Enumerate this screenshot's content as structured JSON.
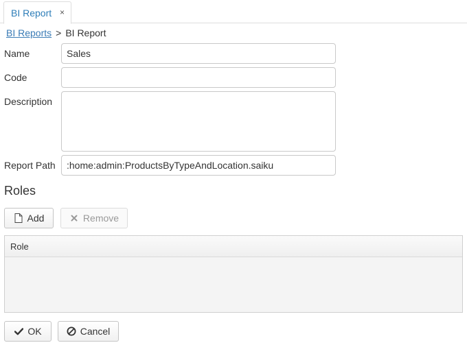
{
  "tab": {
    "title": "BI Report",
    "close_glyph": "×"
  },
  "breadcrumb": {
    "parent_link": "BI Reports",
    "separator": ">",
    "current": "BI Report"
  },
  "form": {
    "name": {
      "label": "Name",
      "value": "Sales"
    },
    "code": {
      "label": "Code",
      "value": ""
    },
    "description": {
      "label": "Description",
      "value": ""
    },
    "report_path": {
      "label": "Report Path",
      "value": ":home:admin:ProductsByTypeAndLocation.saiku"
    }
  },
  "roles": {
    "title": "Roles",
    "add_label": "Add",
    "remove_label": "Remove",
    "remove_enabled": false,
    "columns": [
      "Role"
    ],
    "rows": []
  },
  "footer": {
    "ok_label": "OK",
    "cancel_label": "Cancel"
  },
  "colors": {
    "link": "#3a7bb5",
    "tab_title": "#2d7db8",
    "border": "#c8c8c8"
  }
}
